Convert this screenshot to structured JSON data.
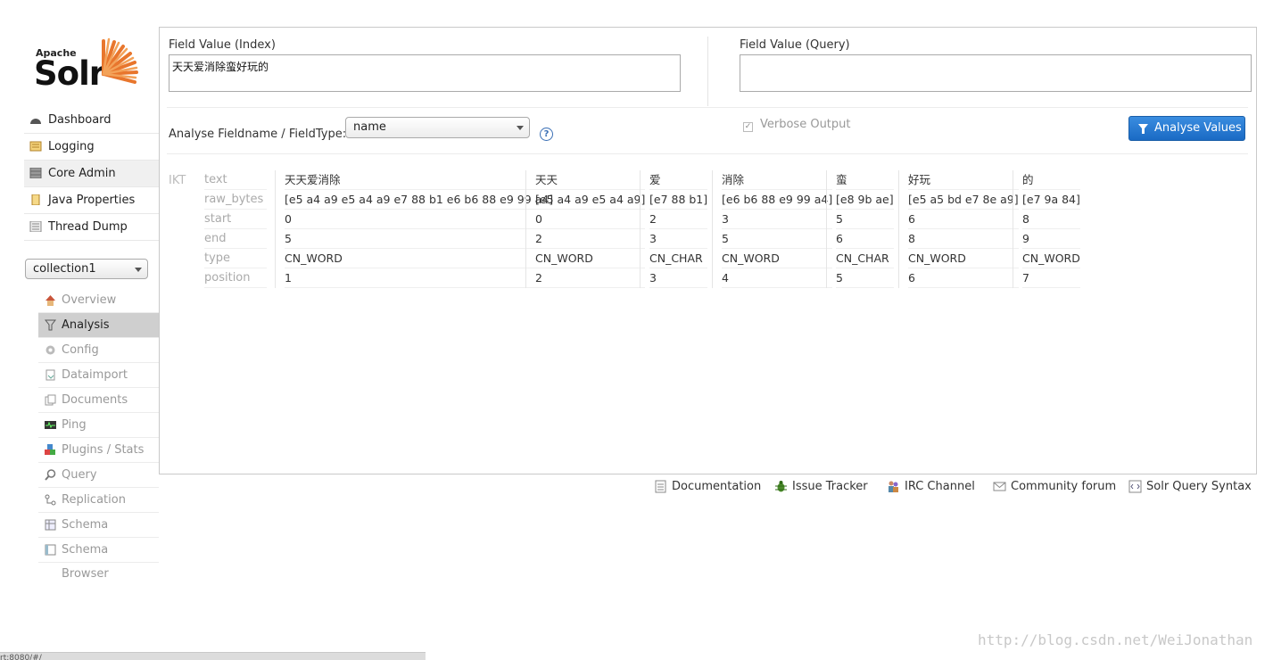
{
  "logo": {
    "top": "Apache",
    "main": "Solr"
  },
  "main_nav": [
    {
      "label": "Dashboard",
      "icon": "dashboard-icon"
    },
    {
      "label": "Logging",
      "icon": "logging-icon"
    },
    {
      "label": "Core Admin",
      "icon": "core-admin-icon"
    },
    {
      "label": "Java Properties",
      "icon": "java-properties-icon"
    },
    {
      "label": "Thread Dump",
      "icon": "thread-dump-icon"
    }
  ],
  "collection_selector": {
    "value": "collection1"
  },
  "core_nav": [
    {
      "label": "Overview",
      "icon": "home-icon"
    },
    {
      "label": "Analysis",
      "icon": "filter-icon"
    },
    {
      "label": "Config",
      "icon": "gear-icon"
    },
    {
      "label": "Dataimport",
      "icon": "dataimport-icon"
    },
    {
      "label": "Documents",
      "icon": "documents-icon"
    },
    {
      "label": "Ping",
      "icon": "ping-icon"
    },
    {
      "label": "Plugins / Stats",
      "icon": "plugins-icon"
    },
    {
      "label": "Query",
      "icon": "magnifier-icon"
    },
    {
      "label": "Replication",
      "icon": "replication-icon"
    },
    {
      "label": "Schema",
      "icon": "schema-icon"
    },
    {
      "label": "Schema Browser",
      "icon": "schema-browser-icon"
    }
  ],
  "analysis": {
    "index_label": "Field Value (Index)",
    "index_value": "天天爱消除蛮好玩的",
    "query_label": "Field Value (Query)",
    "query_value": "",
    "fieldname_label": "Analyse Fieldname / FieldType:",
    "fieldname_value": "name",
    "help": "?",
    "verbose_label": "Verbose Output",
    "verbose_checked": true,
    "button_label": "Analyse Values",
    "tokenizer": "IKT",
    "row_labels": [
      "text",
      "raw_bytes",
      "start",
      "end",
      "type",
      "position"
    ],
    "tokens": [
      {
        "text": "天天爱消除",
        "raw_bytes": "[e5 a4 a9 e5 a4 a9 e7 88 b1 e6 b6 88 e9 99 a4]",
        "start": "0",
        "end": "5",
        "type": "CN_WORD",
        "position": "1"
      },
      {
        "text": "天天",
        "raw_bytes": "[e5 a4 a9 e5 a4 a9]",
        "start": "0",
        "end": "2",
        "type": "CN_WORD",
        "position": "2"
      },
      {
        "text": "爱",
        "raw_bytes": "[e7 88 b1]",
        "start": "2",
        "end": "3",
        "type": "CN_CHAR",
        "position": "3"
      },
      {
        "text": "消除",
        "raw_bytes": "[e6 b6 88 e9 99 a4]",
        "start": "3",
        "end": "5",
        "type": "CN_WORD",
        "position": "4"
      },
      {
        "text": "蛮",
        "raw_bytes": "[e8 9b ae]",
        "start": "5",
        "end": "6",
        "type": "CN_CHAR",
        "position": "5"
      },
      {
        "text": "好玩",
        "raw_bytes": "[e5 a5 bd e7 8e a9]",
        "start": "6",
        "end": "8",
        "type": "CN_WORD",
        "position": "6"
      },
      {
        "text": "的",
        "raw_bytes": "[e7 9a 84]",
        "start": "8",
        "end": "9",
        "type": "CN_WORD",
        "position": "7"
      }
    ]
  },
  "footer": [
    {
      "label": "Documentation",
      "icon": "document-icon"
    },
    {
      "label": "Issue Tracker",
      "icon": "bug-icon"
    },
    {
      "label": "IRC Channel",
      "icon": "people-icon"
    },
    {
      "label": "Community forum",
      "icon": "mail-icon"
    },
    {
      "label": "Solr Query Syntax",
      "icon": "query-syntax-icon"
    }
  ],
  "status_bar": "rt:8080/#/",
  "watermark": "http://blog.csdn.net/WeiJonathan",
  "colors": {
    "accent": "#1a6ac4",
    "active_nav": "#cfcfcf",
    "logo_sun": "#e8762d"
  }
}
